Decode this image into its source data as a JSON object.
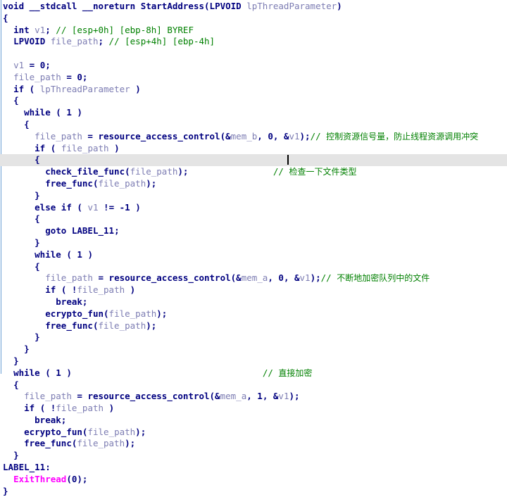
{
  "view": {
    "name": "pseudocode-view",
    "kind": "decompiler-pseudocode",
    "caret_line_index": 13
  },
  "colors": {
    "background": "#ffffff",
    "keyword": "#000080",
    "local_variable": "#7d7db3",
    "comment": "#008000",
    "api_function": "#ff00ff",
    "highlight_row": "#e4e4e4",
    "left_rule": "#6b9fd4",
    "caret": "#000000"
  },
  "code": {
    "lines": [
      {
        "indent": 0,
        "text": "void __stdcall __noreturn StartAddress(LPVOID lpThreadParameter)"
      },
      {
        "indent": 0,
        "text": "{"
      },
      {
        "indent": 1,
        "text": "int v1; // [esp+0h] [ebp-8h] BYREF"
      },
      {
        "indent": 1,
        "text": "LPVOID file_path; // [esp+4h] [ebp-4h]"
      },
      {
        "indent": 0,
        "text": ""
      },
      {
        "indent": 1,
        "text": "v1 = 0;"
      },
      {
        "indent": 1,
        "text": "file_path = 0;"
      },
      {
        "indent": 1,
        "text": "if ( lpThreadParameter )"
      },
      {
        "indent": 1,
        "text": "{"
      },
      {
        "indent": 2,
        "text": "while ( 1 )"
      },
      {
        "indent": 2,
        "text": "{"
      },
      {
        "indent": 3,
        "text": "file_path = resource_access_control(&mem_b, 0, &v1);// 控制资源信号量，防止线程资源调用冲突"
      },
      {
        "indent": 3,
        "text": "if ( file_path )"
      },
      {
        "indent": 3,
        "text": "{"
      },
      {
        "indent": 4,
        "text": "check_file_func(file_path);                // 检查一下文件类型"
      },
      {
        "indent": 4,
        "text": "free_func(file_path);"
      },
      {
        "indent": 3,
        "text": "}"
      },
      {
        "indent": 3,
        "text": "else if ( v1 != -1 )"
      },
      {
        "indent": 3,
        "text": "{"
      },
      {
        "indent": 4,
        "text": "goto LABEL_11;"
      },
      {
        "indent": 3,
        "text": "}"
      },
      {
        "indent": 3,
        "text": "while ( 1 )"
      },
      {
        "indent": 3,
        "text": "{"
      },
      {
        "indent": 4,
        "text": "file_path = resource_access_control(&mem_a, 0, &v1);// 不断地加密队列中的文件"
      },
      {
        "indent": 4,
        "text": "if ( !file_path )"
      },
      {
        "indent": 5,
        "text": "break;"
      },
      {
        "indent": 4,
        "text": "ecrypto_fun(file_path);"
      },
      {
        "indent": 4,
        "text": "free_func(file_path);"
      },
      {
        "indent": 3,
        "text": "}"
      },
      {
        "indent": 2,
        "text": "}"
      },
      {
        "indent": 1,
        "text": "}"
      },
      {
        "indent": 1,
        "text": "while ( 1 )                                    // 直接加密"
      },
      {
        "indent": 1,
        "text": "{"
      },
      {
        "indent": 2,
        "text": "file_path = resource_access_control(&mem_a, 1, &v1);"
      },
      {
        "indent": 2,
        "text": "if ( !file_path )"
      },
      {
        "indent": 3,
        "text": "break;"
      },
      {
        "indent": 2,
        "text": "ecrypto_fun(file_path);"
      },
      {
        "indent": 2,
        "text": "free_func(file_path);"
      },
      {
        "indent": 1,
        "text": "}"
      },
      {
        "indent": 0,
        "text": "LABEL_11:"
      },
      {
        "indent": 1,
        "text": "ExitThread(0);"
      },
      {
        "indent": 0,
        "text": "}"
      }
    ]
  },
  "tokens": {
    "signature": {
      "return_type": "void",
      "calling_convention": "__stdcall",
      "attribute": "__noreturn",
      "function_name": "StartAddress",
      "param_type": "LPVOID",
      "param_name": "lpThreadParameter"
    },
    "declarations": [
      {
        "type": "int",
        "name": "v1",
        "comment": "// [esp+0h] [ebp-8h] BYREF"
      },
      {
        "type": "LPVOID",
        "name": "file_path",
        "comment": "// [esp+4h] [ebp-4h]"
      }
    ],
    "functions_called": [
      "resource_access_control",
      "check_file_func",
      "free_func",
      "ecrypto_fun",
      "ExitThread"
    ],
    "globals": [
      "mem_a",
      "mem_b"
    ],
    "label": "LABEL_11"
  },
  "comments": {
    "stack_v1": "// [esp+0h] [ebp-8h] BYREF",
    "stack_file_path": "// [esp+4h] [ebp-4h]",
    "semaphore": "// 控制资源信号量，防止线程资源调用冲突",
    "check_type": "// 检查一下文件类型",
    "encrypt_queue": "// 不断地加密队列中的文件",
    "direct_encrypt": "// 直接加密"
  }
}
